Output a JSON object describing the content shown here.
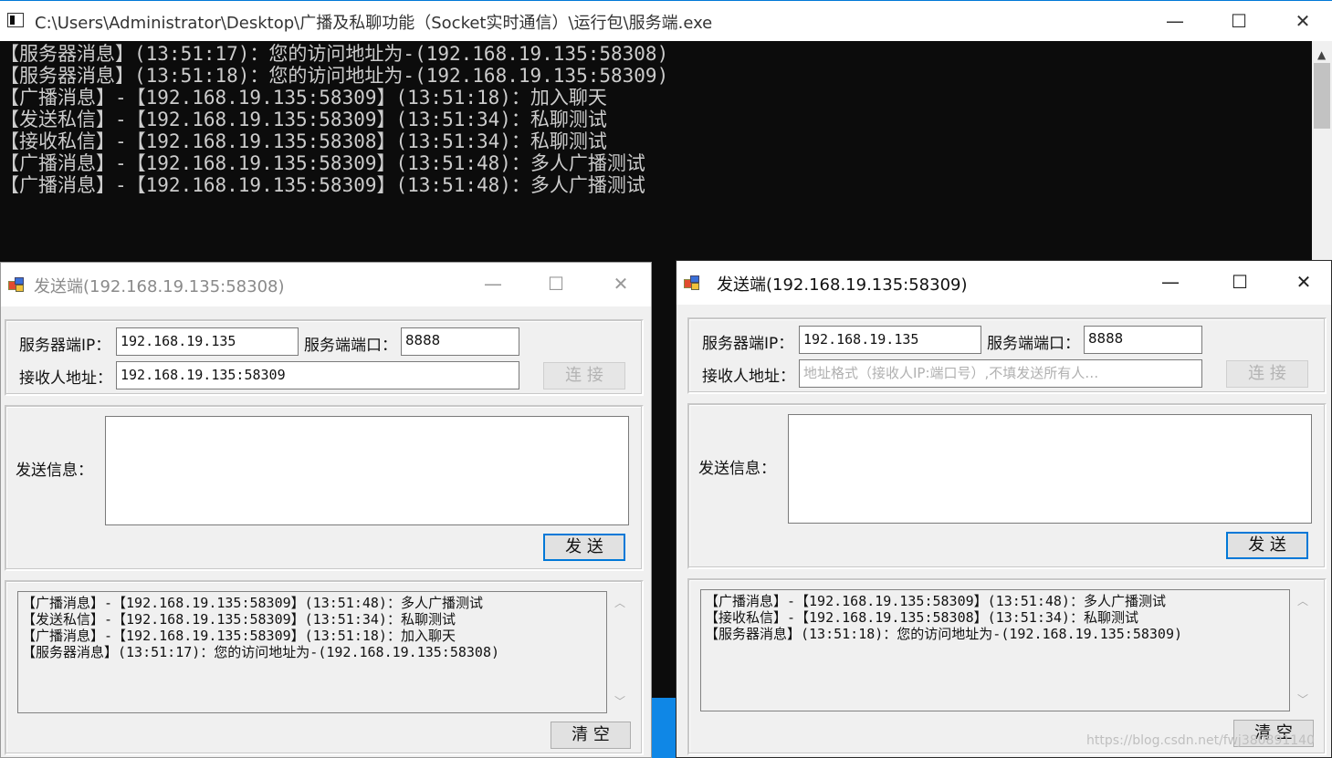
{
  "console": {
    "title": "C:\\Users\\Administrator\\Desktop\\广播及私聊功能（Socket实时通信）\\运行包\\服务端.exe",
    "controls": {
      "minimize": "—",
      "maximize": "☐",
      "close": "✕"
    },
    "lines": [
      "【服务器消息】(13:51:17)：您的访问地址为-(192.168.19.135:58308)",
      "【服务器消息】(13:51:18)：您的访问地址为-(192.168.19.135:58309)",
      "【广播消息】-【192.168.19.135:58309】(13:51:18)：加入聊天",
      "【发送私信】-【192.168.19.135:58309】(13:51:34)：私聊测试",
      "【接收私信】-【192.168.19.135:58308】(13:51:34)：私聊测试",
      "【广播消息】-【192.168.19.135:58309】(13:51:48)：多人广播测试",
      "【广播消息】-【192.168.19.135:58309】(13:51:48)：多人广播测试"
    ]
  },
  "client1": {
    "title": "发送端(192.168.19.135:58308)",
    "controls": {
      "minimize": "—",
      "maximize": "☐",
      "close": "✕"
    },
    "server_ip_label": "服务器端IP：",
    "server_ip": "192.168.19.135",
    "server_port_label": "服务端端口：",
    "server_port": "8888",
    "connect_label": "连  接",
    "recipient_label": "接收人地址：",
    "recipient": "192.168.19.135:58309",
    "message_label": "发送信息：",
    "send_label": "发  送",
    "clear_label": "清  空",
    "log": [
      "【广播消息】-【192.168.19.135:58309】(13:51:48)：多人广播测试",
      "【发送私信】-【192.168.19.135:58309】(13:51:34)：私聊测试",
      "【广播消息】-【192.168.19.135:58309】(13:51:18)：加入聊天",
      "【服务器消息】(13:51:17)：您的访问地址为-(192.168.19.135:58308)"
    ]
  },
  "client2": {
    "title": "发送端(192.168.19.135:58309)",
    "controls": {
      "minimize": "—",
      "maximize": "☐",
      "close": "✕"
    },
    "server_ip_label": "服务器端IP：",
    "server_ip": "192.168.19.135",
    "server_port_label": "服务端端口：",
    "server_port": "8888",
    "connect_label": "连  接",
    "recipient_label": "接收人地址：",
    "recipient_placeholder": "地址格式（接收人IP:端口号）,不填发送所有人…",
    "message_label": "发送信息：",
    "send_label": "发  送",
    "clear_label": "清  空",
    "log": [
      "【广播消息】-【192.168.19.135:58309】(13:51:48)：多人广播测试",
      "【接收私信】-【192.168.19.135:58308】(13:51:34)：私聊测试",
      "【服务器消息】(13:51:18)：您的访问地址为-(192.168.19.135:58309)"
    ]
  },
  "watermark": "https://blog.csdn.net/fwj380891140",
  "colors": {
    "console_bg": "#0c0c0c",
    "console_text": "#cccccc",
    "window_bg": "#f0f0f0",
    "focus_blue": "#0078d7",
    "taskbar_blue": "#0f87e6"
  }
}
